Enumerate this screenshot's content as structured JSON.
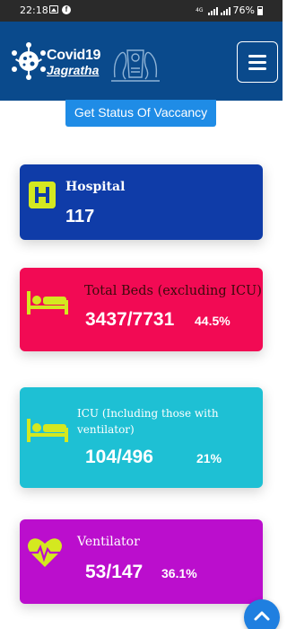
{
  "status_bar": {
    "time": "22:18",
    "network": "4G",
    "battery": "76%"
  },
  "header": {
    "logo_line1": "Covid19",
    "logo_line2": "Jagratha",
    "menu_icon": "hamburger-menu-icon"
  },
  "vacancy_button": "Get Status Of Vaccancy",
  "cards": {
    "hospital": {
      "title": "Hospital",
      "value": "117",
      "icon": "hospital-icon",
      "color": "#0f3ca8"
    },
    "beds": {
      "title": "Total Beds (excluding ICU)",
      "value": "3437/7731",
      "percent": "44.5%",
      "icon": "bed-icon",
      "color": "#f20a54"
    },
    "icu": {
      "title": "ICU (Including those with ventilator)",
      "value": "104/496",
      "percent": "21%",
      "icon": "bed-icon",
      "color": "#1ec0d4"
    },
    "ventilator": {
      "title": "Ventilator",
      "value": "53/147",
      "percent": "36.1%",
      "icon": "heart-pulse-icon",
      "color": "#bb0ecd"
    }
  },
  "colors": {
    "header": "#0a4a8c",
    "accent_button": "#1f8ce6",
    "icon_accent": "#d4e820"
  }
}
